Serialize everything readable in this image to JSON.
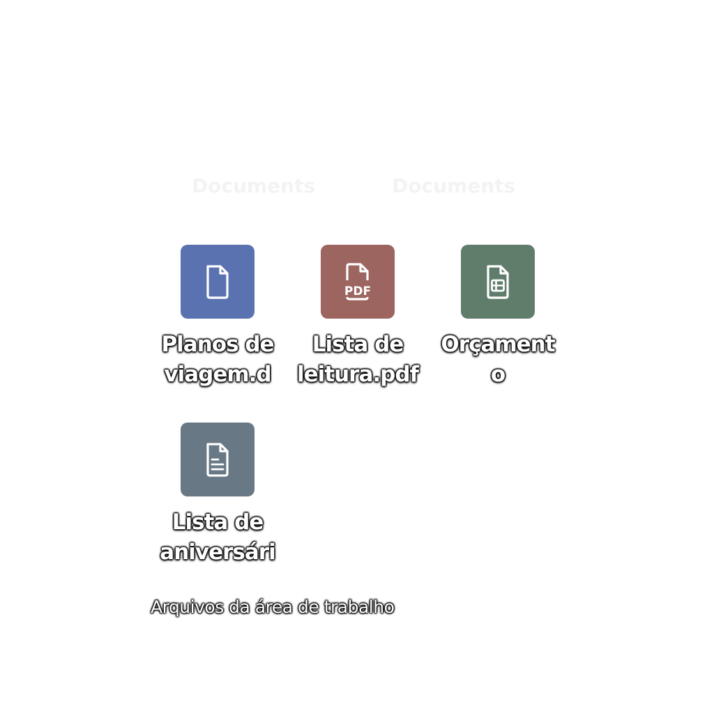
{
  "header": {
    "part1": "Documents",
    "part2": "Documents"
  },
  "desktop": {
    "icons": [
      {
        "label_line1": "Planos de",
        "label_line2": "viagem.d",
        "icon": "document-icon",
        "color": "#5b72b0"
      },
      {
        "label_line1": "Lista de",
        "label_line2": "leitura.pdf",
        "icon": "pdf-icon",
        "color": "#9c6560"
      },
      {
        "label_line1": "Orçament",
        "label_line2": "o",
        "icon": "spreadsheet-icon",
        "color": "#607d6c"
      },
      {
        "label_line1": "Lista de",
        "label_line2": "aniversári",
        "icon": "text-document-icon",
        "color": "#687885"
      }
    ],
    "footer_label": "Arquivos da área de trabalho"
  }
}
